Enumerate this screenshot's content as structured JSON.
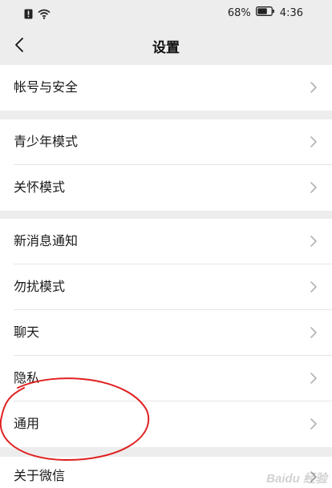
{
  "status_bar": {
    "battery_percent": "68%",
    "time": "4:36",
    "icons": [
      "sim-alert-icon",
      "wifi-icon",
      "battery-icon"
    ]
  },
  "nav": {
    "back_icon": "chevron-left-icon",
    "title": "设置"
  },
  "groups": [
    {
      "items": [
        {
          "label": "帐号与安全"
        }
      ]
    },
    {
      "items": [
        {
          "label": "青少年模式"
        },
        {
          "label": "关怀模式"
        }
      ]
    },
    {
      "items": [
        {
          "label": "新消息通知"
        },
        {
          "label": "勿扰模式"
        },
        {
          "label": "聊天"
        },
        {
          "label": "隐私"
        },
        {
          "label": "通用"
        }
      ]
    },
    {
      "items": [
        {
          "label": "关于微信"
        }
      ]
    }
  ],
  "annotation": {
    "shape": "ellipse",
    "color": "#e02020",
    "highlights": "通用"
  },
  "watermark": "Baidu 经验",
  "colors": {
    "background": "#ededed",
    "card": "#ffffff",
    "chevron": "#b2b2b2",
    "annotation": "#e02020"
  }
}
